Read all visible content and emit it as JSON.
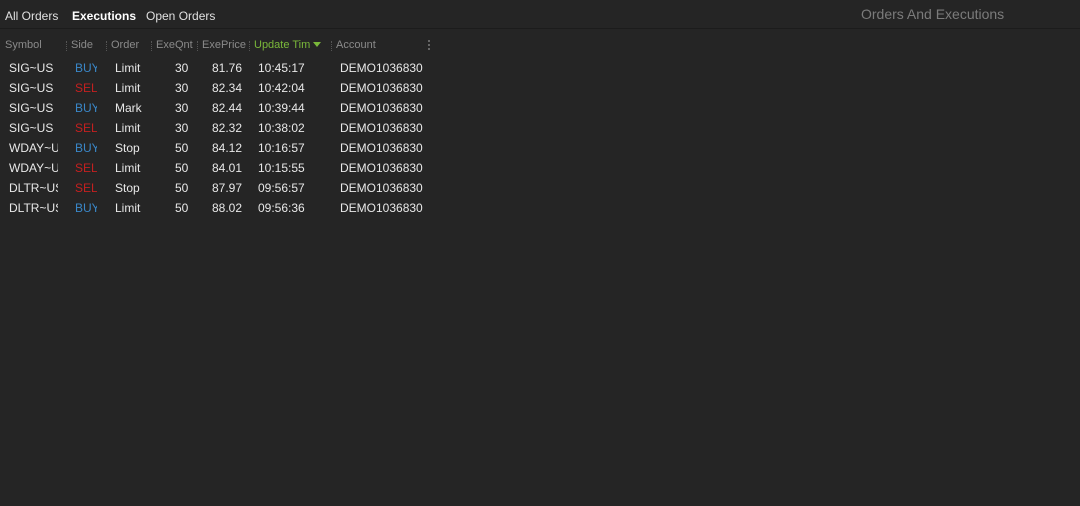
{
  "tabs": [
    {
      "label": "All Orders",
      "active": false
    },
    {
      "label": "Executions",
      "active": true
    },
    {
      "label": "Open Orders",
      "active": false
    }
  ],
  "panel_title": "Orders And Executions",
  "columns": [
    "Symbol",
    "Side",
    "Order",
    "ExeQnt",
    "ExePrice",
    "Update Tim",
    "Account"
  ],
  "sorted_column": "Update Tim",
  "colors": {
    "buy": "#3a87c8",
    "sell": "#c42020",
    "sorted_header": "#7ab83a"
  },
  "rows": [
    {
      "symbol": "SIG~US",
      "side": "BUY",
      "order": "Limit",
      "qty": "30",
      "price": "81.76",
      "time": "10:45:17",
      "account": "DEMO1036830"
    },
    {
      "symbol": "SIG~US",
      "side": "SELL",
      "order": "Limit",
      "qty": "30",
      "price": "82.34",
      "time": "10:42:04",
      "account": "DEMO1036830"
    },
    {
      "symbol": "SIG~US",
      "side": "BUY",
      "order": "Mark",
      "qty": "30",
      "price": "82.44",
      "time": "10:39:44",
      "account": "DEMO1036830"
    },
    {
      "symbol": "SIG~US",
      "side": "SELL",
      "order": "Limit",
      "qty": "30",
      "price": "82.32",
      "time": "10:38:02",
      "account": "DEMO1036830"
    },
    {
      "symbol": "WDAY~US",
      "side": "BUY",
      "order": "Stop",
      "qty": "50",
      "price": "84.12",
      "time": "10:16:57",
      "account": "DEMO1036830"
    },
    {
      "symbol": "WDAY~US",
      "side": "SELL",
      "order": "Limit",
      "qty": "50",
      "price": "84.01",
      "time": "10:15:55",
      "account": "DEMO1036830"
    },
    {
      "symbol": "DLTR~US",
      "side": "SELL",
      "order": "Stop",
      "qty": "50",
      "price": "87.97",
      "time": "09:56:57",
      "account": "DEMO1036830"
    },
    {
      "symbol": "DLTR~US",
      "side": "BUY",
      "order": "Limit",
      "qty": "50",
      "price": "88.02",
      "time": "09:56:36",
      "account": "DEMO1036830"
    }
  ]
}
